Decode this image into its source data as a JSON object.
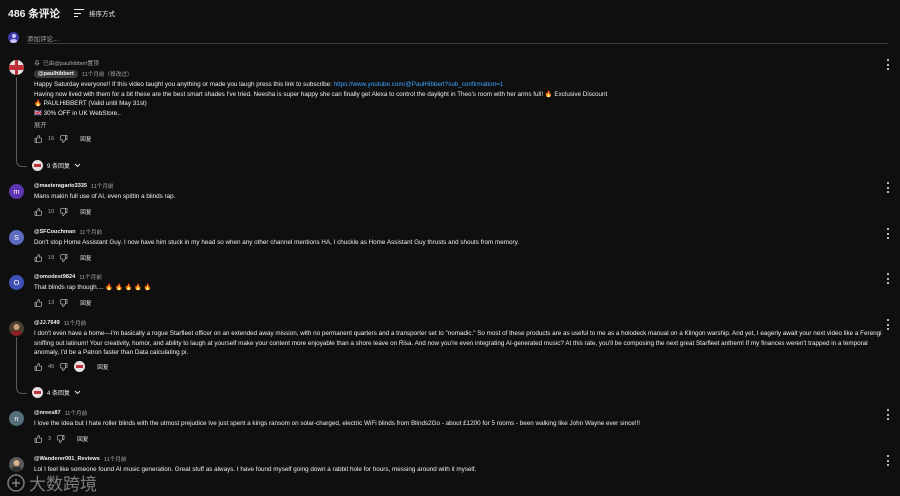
{
  "header": {
    "count_label": "486 条评论",
    "sort_label": "排序方式"
  },
  "add_comment": {
    "placeholder": "添加评论..."
  },
  "pinned": {
    "pinned_label": "已由@paulhibbert置顶",
    "author": "@paulhibbert",
    "time": "11个月前（修改过）",
    "line1_pre": "Happy Saturday everyone!!  If this video taught you anything or made you laugh press this link to subscribe: ",
    "line1_link": "https://www.youtube.com/@PaulHibbert?sub_confirmation=1",
    "line2": "Having now lived with them for a bit these are the best smart shades I've tried.  Neesha is super happy she can finally get Alexa to control the daylight in Theo's room with her arms full! 🔥 Exclusive Discount",
    "line3": "🔥 PAULHIBBERT (Valid until May 31st)",
    "line4": "🇬🇧 30% OFF in UK WebStore..",
    "expand": "展开",
    "likes": "16",
    "reply": "回复",
    "replies_label": "9 条回复"
  },
  "comments": [
    {
      "avatar_letter": "m",
      "avatar_color": "#5e35b1",
      "author": "@masteragario3335",
      "time": "11个月前",
      "text": "Mans makin full use of AI, even spittin a blinds rap.",
      "likes": "10",
      "reply": "回复"
    },
    {
      "avatar_letter": "S",
      "avatar_color": "#5c6bc0",
      "author": "@SFCouchman",
      "time": "11个月前",
      "text": "Don't stop Home Assistant Guy. I now have him stuck in my head so when any other channel mentions HA, I chuckle as Home Assistant Guy thrusts and shouts from memory.",
      "likes": "19",
      "reply": "回复"
    },
    {
      "avatar_letter": "O",
      "avatar_color": "#3f51b5",
      "author": "@omodest9824",
      "time": "11个月前",
      "text": "That blinds rap though.... 🔥 🔥 🔥 🔥 🔥",
      "likes": "13",
      "reply": "回复"
    },
    {
      "avatar_letter": "",
      "avatar_color": "#5a4a3a",
      "author": "@JJ.7649",
      "time": "11个月前",
      "text": "I don't even have a home—I'm basically a rogue Starfleet officer on an extended away mission, with no permanent quarters and a transporter set to \"nomadic.\" So most of these products are as useful to me as a holodeck manual on a Klingon warship. And yet, I eagerly await your next video like a Ferengi sniffing out latinum! Your creativity, humor, and ability to laugh at yourself make your content more enjoyable than a shore leave on Risa. And now you're even integrating AI-generated music? At this rate, you'll be composing the next great Starfleet anthem! If my finances weren't trapped in a temporal anomaly, I'd be a Patron faster than Data calculating pi.",
      "likes": "45",
      "reply": "回复",
      "replies_label": "4 条回复"
    },
    {
      "avatar_letter": "n",
      "avatar_color": "#546e7a",
      "author": "@nrees87",
      "time": "11个月前",
      "text": "I love the idea but I hate roller blinds with the utmost prejudice        Ive just spent a kings ransom on solar-charged, electric WiFi blinds from Blinds2Go - about £1200 for 5 rooms - been walking like John Wayne ever since!!!",
      "likes": "3",
      "reply": "回复"
    },
    {
      "avatar_letter": "",
      "avatar_color": "#6d6d6d",
      "author": "@Wanderer001_Reviews",
      "time": "11个月前",
      "text": "Lol I feel like someone found AI music generation.  Great stuff as always.  I have found myself going down a rabbit hole for hours, messing around with it myself.",
      "likes": "",
      "reply": "回复"
    }
  ],
  "watermark": {
    "text": "大数跨境"
  }
}
